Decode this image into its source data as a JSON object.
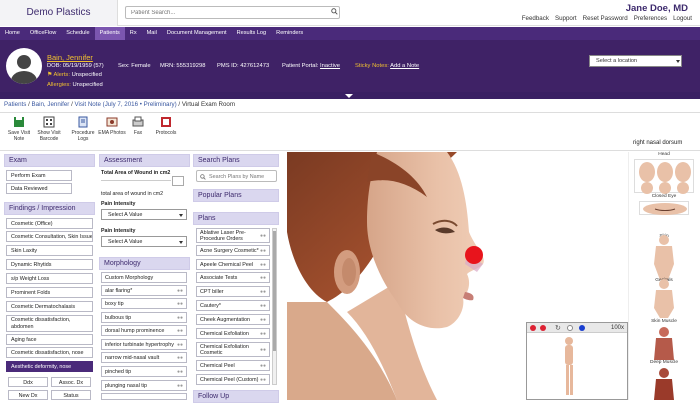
{
  "app": {
    "brand": "Demo Plastics",
    "user_name": "Jane Doe, MD"
  },
  "search": {
    "placeholder": "Patient Search..."
  },
  "top_links": [
    "Feedback",
    "Support",
    "Reset Password",
    "Preferences",
    "Logout"
  ],
  "nav": [
    {
      "label": "Home",
      "active": false
    },
    {
      "label": "OfficeFlow",
      "active": false
    },
    {
      "label": "Schedule",
      "active": false
    },
    {
      "label": "Patients",
      "active": true
    },
    {
      "label": "Rx",
      "active": false
    },
    {
      "label": "Mail",
      "active": false
    },
    {
      "label": "Document Management",
      "active": false
    },
    {
      "label": "Results Log",
      "active": false
    },
    {
      "label": "Reminders",
      "active": false
    }
  ],
  "patient": {
    "name": "Bain, Jennifer",
    "dob": "DOB: 05/19/1959 (57)",
    "sex": "Sex: Female",
    "mrn": "MRN: 555319298",
    "pms": "PMS ID: 427612473",
    "portal_label": "Patient Portal:",
    "portal_value": "Inactive",
    "sticky_label": "Sticky Notes:",
    "sticky_value": "Add a Note",
    "alerts_label": "Alerts:",
    "alerts_value": "Unspecified",
    "allergies_label": "Allergies:",
    "allergies_value": "Unspecified",
    "location_placeholder": "Select a location"
  },
  "breadcrumb": {
    "patients": "Patients",
    "name": "Bain, Jennifer",
    "visit": "Visit Note (July 7, 2016 • Preliminary)",
    "current": "Virtual Exam Room"
  },
  "toolbar": [
    {
      "label": "Save Visit Note",
      "icon": "save-icon",
      "color": "#2a8a3a"
    },
    {
      "label": "Show Visit Barcode",
      "icon": "barcode-icon",
      "color": "#444444"
    },
    {
      "label": "Procedure Logs",
      "icon": "procedure-logs-icon",
      "color": "#3a58a0"
    },
    {
      "label": "EMA Photos",
      "icon": "photos-icon",
      "color": "#8b3a2a"
    },
    {
      "label": "Fax",
      "icon": "fax-icon",
      "color": "#555555"
    },
    {
      "label": "Protocols",
      "icon": "protocols-icon",
      "color": "#c0282e"
    }
  ],
  "region_label": "right nasal dorsum",
  "exam": {
    "header": "Exam",
    "items": [
      "Perform Exam",
      "Data Reviewed"
    ]
  },
  "findings": {
    "header": "Findings / Impression",
    "items": [
      "Cosmetic (Office)",
      "Cosmetic Consultation, Skin Issues",
      "Skin Laxity",
      "Dynamic Rhytids",
      "s/p Weight Loss",
      "Prominent Folds",
      "Cosmetic Dermatochalasis",
      "Cosmetic dissatisfaction, abdomen",
      "Aging face",
      "Cosmetic dissatisfaction, nose",
      "Aesthetic deformity, nose"
    ],
    "buttons": [
      "Ddx",
      "Assoc. Dx",
      "New Dx",
      "Status"
    ]
  },
  "assessment": {
    "header": "Assessment",
    "wound_label": "Total Area of Wound in cm2",
    "wound_text": "total area of wound in cm2",
    "pain1_label": "Pain Intensity",
    "pain1_value": "Select A Value",
    "pain2_label": "Pain Intensity",
    "pain2_value": "Select A Value"
  },
  "morphology": {
    "header": "Morphology",
    "items": [
      "Custom Morphology",
      "alar flaring*",
      "boxy tip",
      "bulbous tip",
      "dorsal hump prominence",
      "inferior turbinate hypertrophy",
      "narrow mid-nasal vault",
      "pinched tip",
      "plunging nasal tip"
    ]
  },
  "search_plans": {
    "header": "Search Plans",
    "placeholder": "Search Plans by Name"
  },
  "popular_plans": {
    "header": "Popular Plans"
  },
  "plans": {
    "header": "Plans",
    "items": [
      "Ablative Laser Pre-Procedure Orders",
      "Acne Surgery Cosmetic*",
      "Apeele Chemical Peel",
      "Associate Tests",
      "CPT biller",
      "Cautery*",
      "Cheek Augmentation",
      "Chemical Exfoliation",
      "Chemical Exfoliation Cosmetic",
      "Chemical Peel",
      "Chemical Peel (Custom)"
    ]
  },
  "follow_up": {
    "header": "Follow Up"
  },
  "thumbnails": [
    "Head",
    "Closed Eye",
    "Skin",
    "Genitals",
    "Skin Muscle",
    "Deep Muscle"
  ],
  "popup": {
    "zoom": "100x"
  },
  "colors": {
    "brand_purple": "#4a2a7a",
    "banner": "#3f2266",
    "accent_yellow": "#f0c030",
    "marker_red": "#e8141c"
  }
}
